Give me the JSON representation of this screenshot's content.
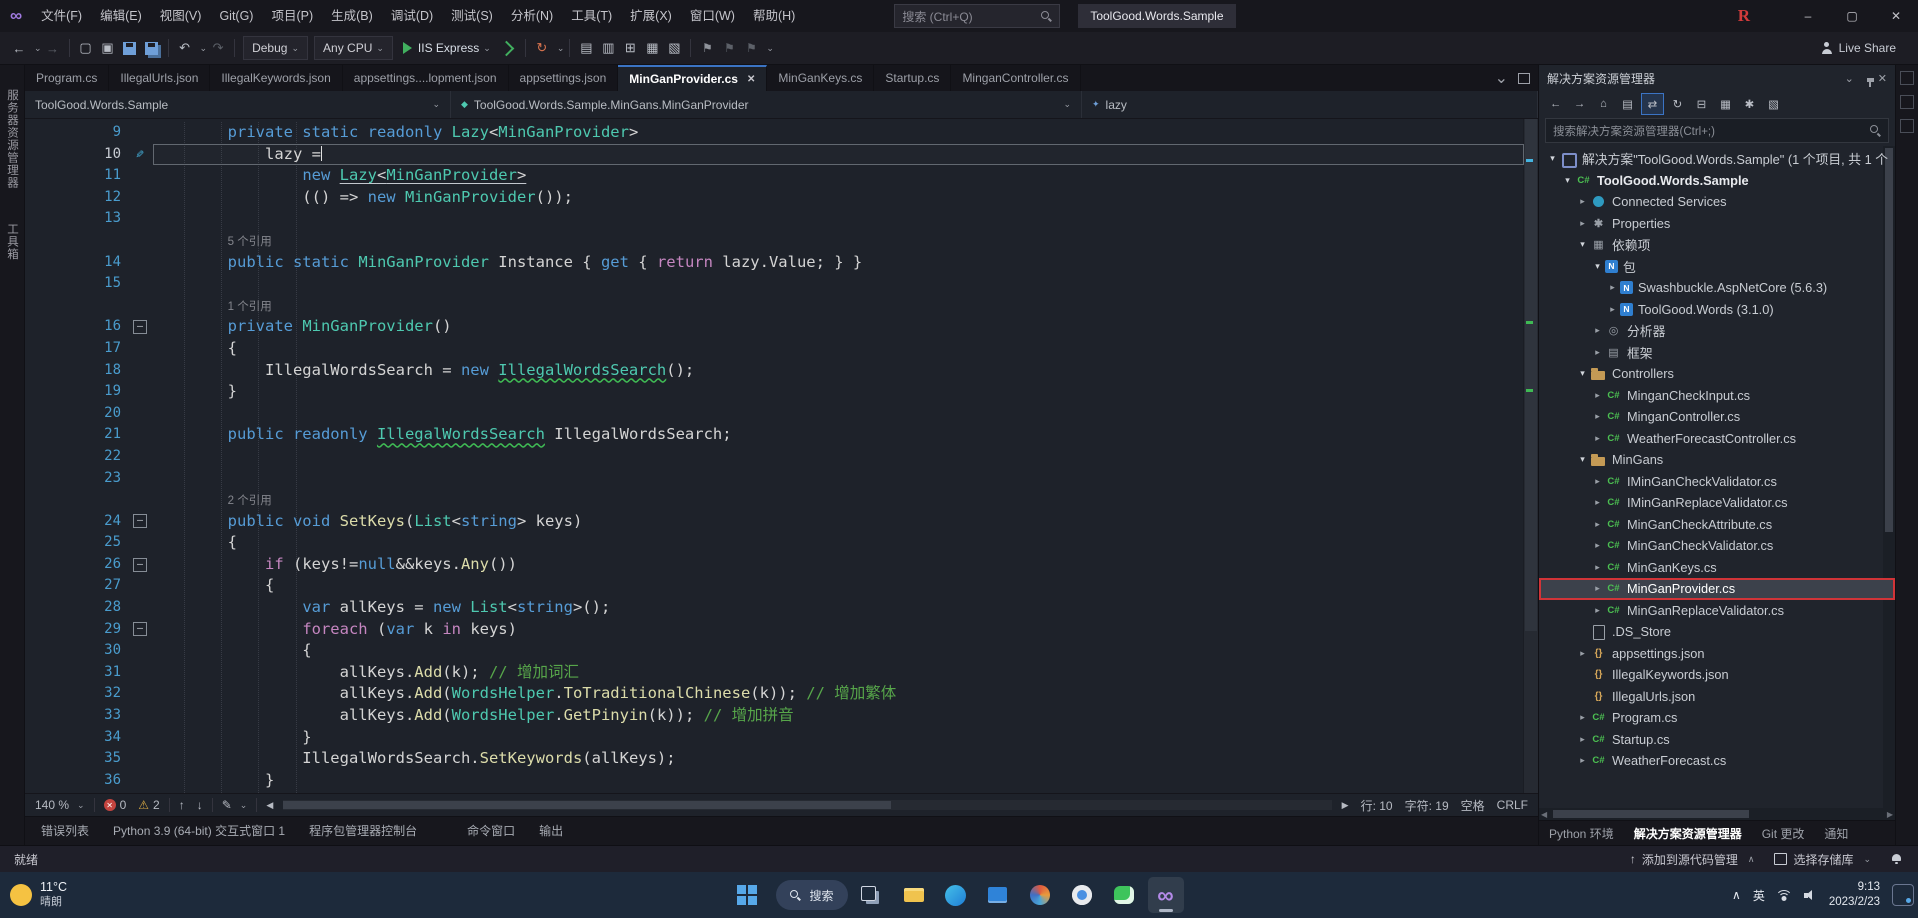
{
  "icons": {
    "minimize": "–",
    "maximize": "▢",
    "close": "✕",
    "chevron_down": "⌄",
    "chevron_up": "∧",
    "warning": "⚠",
    "pen": "✎",
    "arrow_up": "↑",
    "arrow_down": "↓",
    "arrow_left": "◀",
    "arrow_right": "▶",
    "back": "←",
    "forward": "→",
    "undo": "↶",
    "redo": "↷",
    "refresh": "↻",
    "infinity": "∞",
    "flag": "⚑",
    "tree_collapsed": "▸",
    "tree_expanded": "▾",
    "fold_minus": "–"
  },
  "titlebar": {
    "menus": [
      "文件(F)",
      "编辑(E)",
      "视图(V)",
      "Git(G)",
      "项目(P)",
      "生成(B)",
      "调试(D)",
      "测试(S)",
      "分析(N)",
      "工具(T)",
      "扩展(X)",
      "窗口(W)",
      "帮助(H)"
    ],
    "search_placeholder": "搜索 (Ctrl+Q)",
    "title_box": "ToolGood.Words.Sample",
    "r_badge": "R"
  },
  "toolbar": {
    "debug_config": "Debug",
    "platform": "Any CPU",
    "run_label": "IIS Express",
    "live_share": "Live Share"
  },
  "tabs": [
    {
      "label": "Program.cs",
      "active": false
    },
    {
      "label": "IllegalUrls.json",
      "active": false
    },
    {
      "label": "IllegalKeywords.json",
      "active": false
    },
    {
      "label": "appsettings....lopment.json",
      "active": false
    },
    {
      "label": "appsettings.json",
      "active": false
    },
    {
      "label": "MinGanProvider.cs",
      "active": true
    },
    {
      "label": "MinGanKeys.cs",
      "active": false
    },
    {
      "label": "Startup.cs",
      "active": false
    },
    {
      "label": "MinganController.cs",
      "active": false
    }
  ],
  "breadcrumb": {
    "project": "ToolGood.Words.Sample",
    "type": "ToolGood.Words.Sample.MinGans.MinGanProvider",
    "member": "lazy"
  },
  "editor": {
    "current_line": 10,
    "rows": [
      {
        "n": 9,
        "segs": [
          {
            "t": "        ",
            "c": "pl"
          },
          {
            "t": "private static readonly ",
            "c": "kw"
          },
          {
            "t": "Lazy",
            "c": "ty"
          },
          {
            "t": "<",
            "c": "pl"
          },
          {
            "t": "MinGanProvider",
            "c": "ty"
          },
          {
            "t": ">",
            "c": "pl"
          }
        ]
      },
      {
        "n": 10,
        "cur": true,
        "pen": true,
        "segs": [
          {
            "t": "            lazy =",
            "c": "pl"
          }
        ]
      },
      {
        "n": 11,
        "segs": [
          {
            "t": "                ",
            "c": "pl"
          },
          {
            "t": "new ",
            "c": "kw"
          },
          {
            "t": "Lazy",
            "c": "ty ul"
          },
          {
            "t": "<",
            "c": "pl ul"
          },
          {
            "t": "MinGanProvider",
            "c": "ty ul"
          },
          {
            "t": ">",
            "c": "pl ul"
          }
        ]
      },
      {
        "n": 12,
        "segs": [
          {
            "t": "                (() => ",
            "c": "pl"
          },
          {
            "t": "new ",
            "c": "kw"
          },
          {
            "t": "MinGanProvider",
            "c": "ty"
          },
          {
            "t": "());",
            "c": "pl"
          }
        ]
      },
      {
        "n": 13,
        "segs": []
      },
      {
        "cl": "5 个引用"
      },
      {
        "n": 14,
        "segs": [
          {
            "t": "        ",
            "c": "pl"
          },
          {
            "t": "public static ",
            "c": "kw"
          },
          {
            "t": "MinGanProvider",
            "c": "ty"
          },
          {
            "t": " Instance { ",
            "c": "pl"
          },
          {
            "t": "get",
            "c": "kw"
          },
          {
            "t": " { ",
            "c": "pl"
          },
          {
            "t": "return",
            "c": "cf"
          },
          {
            "t": " lazy.Value; } }",
            "c": "pl"
          }
        ]
      },
      {
        "n": 15,
        "segs": []
      },
      {
        "cl": "1 个引用"
      },
      {
        "n": 16,
        "fold": true,
        "segs": [
          {
            "t": "        ",
            "c": "pl"
          },
          {
            "t": "private ",
            "c": "kw"
          },
          {
            "t": "MinGanProvider",
            "c": "ty"
          },
          {
            "t": "()",
            "c": "pl"
          }
        ]
      },
      {
        "n": 17,
        "segs": [
          {
            "t": "        {",
            "c": "pl"
          }
        ]
      },
      {
        "n": 18,
        "segs": [
          {
            "t": "            IllegalWordsSearch = ",
            "c": "pl"
          },
          {
            "t": "new ",
            "c": "kw"
          },
          {
            "t": "IllegalWordsSearch",
            "c": "ty sq"
          },
          {
            "t": "();",
            "c": "pl"
          }
        ]
      },
      {
        "n": 19,
        "segs": [
          {
            "t": "        }",
            "c": "pl"
          }
        ]
      },
      {
        "n": 20,
        "segs": []
      },
      {
        "n": 21,
        "segs": [
          {
            "t": "        ",
            "c": "pl"
          },
          {
            "t": "public readonly ",
            "c": "kw"
          },
          {
            "t": "IllegalWordsSearch",
            "c": "ty sq"
          },
          {
            "t": " IllegalWordsSearch;",
            "c": "pl"
          }
        ]
      },
      {
        "n": 22,
        "segs": []
      },
      {
        "n": 23,
        "segs": []
      },
      {
        "cl": "2 个引用"
      },
      {
        "n": 24,
        "fold": true,
        "segs": [
          {
            "t": "        ",
            "c": "pl"
          },
          {
            "t": "public void ",
            "c": "kw"
          },
          {
            "t": "SetKeys",
            "c": "me"
          },
          {
            "t": "(",
            "c": "pl"
          },
          {
            "t": "List",
            "c": "ty"
          },
          {
            "t": "<",
            "c": "pl"
          },
          {
            "t": "string",
            "c": "kw"
          },
          {
            "t": "> keys)",
            "c": "pl"
          }
        ]
      },
      {
        "n": 25,
        "segs": [
          {
            "t": "        {",
            "c": "pl"
          }
        ]
      },
      {
        "n": 26,
        "fold": true,
        "segs": [
          {
            "t": "            ",
            "c": "pl"
          },
          {
            "t": "if",
            "c": "cf"
          },
          {
            "t": " (keys!=",
            "c": "pl"
          },
          {
            "t": "null",
            "c": "kw"
          },
          {
            "t": "&&keys.",
            "c": "pl"
          },
          {
            "t": "Any",
            "c": "me"
          },
          {
            "t": "())",
            "c": "pl"
          }
        ]
      },
      {
        "n": 27,
        "segs": [
          {
            "t": "            {",
            "c": "pl"
          }
        ]
      },
      {
        "n": 28,
        "segs": [
          {
            "t": "                ",
            "c": "pl"
          },
          {
            "t": "var",
            "c": "kw"
          },
          {
            "t": " allKeys = ",
            "c": "pl"
          },
          {
            "t": "new ",
            "c": "kw"
          },
          {
            "t": "List",
            "c": "ty"
          },
          {
            "t": "<",
            "c": "pl"
          },
          {
            "t": "string",
            "c": "kw"
          },
          {
            "t": ">();",
            "c": "pl"
          }
        ]
      },
      {
        "n": 29,
        "fold": true,
        "segs": [
          {
            "t": "                ",
            "c": "pl"
          },
          {
            "t": "foreach",
            "c": "cf"
          },
          {
            "t": " (",
            "c": "pl"
          },
          {
            "t": "var",
            "c": "kw"
          },
          {
            "t": " k ",
            "c": "pl"
          },
          {
            "t": "in",
            "c": "cf"
          },
          {
            "t": " keys)",
            "c": "pl"
          }
        ]
      },
      {
        "n": 30,
        "segs": [
          {
            "t": "                {",
            "c": "pl"
          }
        ]
      },
      {
        "n": 31,
        "segs": [
          {
            "t": "                    allKeys.",
            "c": "pl"
          },
          {
            "t": "Add",
            "c": "me"
          },
          {
            "t": "(k); ",
            "c": "pl"
          },
          {
            "t": "// 增加词汇",
            "c": "cm"
          }
        ]
      },
      {
        "n": 32,
        "segs": [
          {
            "t": "                    allKeys.",
            "c": "pl"
          },
          {
            "t": "Add",
            "c": "me"
          },
          {
            "t": "(",
            "c": "pl"
          },
          {
            "t": "WordsHelper",
            "c": "ty"
          },
          {
            "t": ".",
            "c": "pl"
          },
          {
            "t": "ToTraditionalChinese",
            "c": "me"
          },
          {
            "t": "(k)); ",
            "c": "pl"
          },
          {
            "t": "// 增加繁体",
            "c": "cm"
          }
        ]
      },
      {
        "n": 33,
        "segs": [
          {
            "t": "                    allKeys.",
            "c": "pl"
          },
          {
            "t": "Add",
            "c": "me"
          },
          {
            "t": "(",
            "c": "pl"
          },
          {
            "t": "WordsHelper",
            "c": "ty"
          },
          {
            "t": ".",
            "c": "pl"
          },
          {
            "t": "GetPinyin",
            "c": "me"
          },
          {
            "t": "(k)); ",
            "c": "pl"
          },
          {
            "t": "// 增加拼音",
            "c": "cm"
          }
        ]
      },
      {
        "n": 34,
        "segs": [
          {
            "t": "                }",
            "c": "pl"
          }
        ]
      },
      {
        "n": 35,
        "segs": [
          {
            "t": "                IllegalWordsSearch.",
            "c": "pl"
          },
          {
            "t": "SetKeywords",
            "c": "me"
          },
          {
            "t": "(allKeys);",
            "c": "pl"
          }
        ]
      },
      {
        "n": 36,
        "segs": [
          {
            "t": "            }",
            "c": "pl"
          }
        ]
      }
    ]
  },
  "editor_status": {
    "zoom": "140 %",
    "errors": "0",
    "warnings": "2",
    "line_label": "行: 10",
    "char_label": "字符: 19",
    "space_label": "空格",
    "eol": "CRLF"
  },
  "left_strip": {
    "tabs": [
      "服务器资源管理器",
      "工具箱"
    ]
  },
  "bottom_panel": {
    "groups": [
      [
        "错误列表",
        "Python 3.9 (64-bit) 交互式窗口 1",
        "程序包管理器控制台"
      ],
      [
        "命令窗口",
        "输出"
      ]
    ]
  },
  "solution_explorer": {
    "title": "解决方案资源管理器",
    "search_placeholder": "搜索解决方案资源管理器(Ctrl+;)",
    "toolbar_icons": [
      "back",
      "forward",
      "home",
      "switch-views",
      "sync-with-active-document",
      "refresh",
      "collapse-all",
      "show-all-files",
      "properties",
      "preview"
    ],
    "tree": [
      {
        "level": 0,
        "arrow": "e",
        "icon": "sln",
        "label": "解决方案\"ToolGood.Words.Sample\" (1 个项目, 共 1 个"
      },
      {
        "level": 1,
        "arrow": "e",
        "icon": "proj",
        "label": "ToolGood.Words.Sample",
        "bold": true
      },
      {
        "level": 2,
        "arrow": "c",
        "icon": "svc",
        "label": "Connected Services"
      },
      {
        "level": 2,
        "arrow": "c",
        "icon": "props",
        "label": "Properties"
      },
      {
        "level": 2,
        "arrow": "e",
        "icon": "dep",
        "label": "依赖项"
      },
      {
        "level": 3,
        "arrow": "e",
        "icon": "nuget",
        "label": "包"
      },
      {
        "level": 4,
        "arrow": "c",
        "icon": "pkg",
        "label": "Swashbuckle.AspNetCore (5.6.3)"
      },
      {
        "level": 4,
        "arrow": "c",
        "icon": "pkg",
        "label": "ToolGood.Words (3.1.0)"
      },
      {
        "level": 3,
        "arrow": "c",
        "icon": "analyzer",
        "label": "分析器"
      },
      {
        "level": 3,
        "arrow": "c",
        "icon": "fw",
        "label": "框架"
      },
      {
        "level": 2,
        "arrow": "e",
        "icon": "folder",
        "label": "Controllers"
      },
      {
        "level": 3,
        "arrow": "c",
        "icon": "cs",
        "label": "MinganCheckInput.cs"
      },
      {
        "level": 3,
        "arrow": "c",
        "icon": "cs",
        "label": "MinganController.cs"
      },
      {
        "level": 3,
        "arrow": "c",
        "icon": "cs",
        "label": "WeatherForecastController.cs"
      },
      {
        "level": 2,
        "arrow": "e",
        "icon": "folder",
        "label": "MinGans"
      },
      {
        "level": 3,
        "arrow": "c",
        "icon": "cs",
        "label": "IMinGanCheckValidator.cs"
      },
      {
        "level": 3,
        "arrow": "c",
        "icon": "cs",
        "label": "IMinGanReplaceValidator.cs"
      },
      {
        "level": 3,
        "arrow": "c",
        "icon": "cs",
        "label": "MinGanCheckAttribute.cs"
      },
      {
        "level": 3,
        "arrow": "c",
        "icon": "cs",
        "label": "MinGanCheckValidator.cs"
      },
      {
        "level": 3,
        "arrow": "c",
        "icon": "cs",
        "label": "MinGanKeys.cs"
      },
      {
        "level": 3,
        "arrow": "c",
        "icon": "cs",
        "label": "MinGanProvider.cs",
        "selected": true
      },
      {
        "level": 3,
        "arrow": "c",
        "icon": "cs",
        "label": "MinGanReplaceValidator.cs"
      },
      {
        "level": 2,
        "arrow": "n",
        "icon": "file",
        "label": ".DS_Store"
      },
      {
        "level": 2,
        "arrow": "c",
        "icon": "json",
        "label": "appsettings.json"
      },
      {
        "level": 2,
        "arrow": "n",
        "icon": "json",
        "label": "IllegalKeywords.json"
      },
      {
        "level": 2,
        "arrow": "n",
        "icon": "json",
        "label": "IllegalUrls.json"
      },
      {
        "level": 2,
        "arrow": "c",
        "icon": "cs",
        "label": "Program.cs"
      },
      {
        "level": 2,
        "arrow": "c",
        "icon": "cs",
        "label": "Startup.cs"
      },
      {
        "level": 2,
        "arrow": "c",
        "icon": "cs",
        "label": "WeatherForecast.cs"
      }
    ],
    "dock_tabs": [
      {
        "label": "Python 环境",
        "active": false
      },
      {
        "label": "解决方案资源管理器",
        "active": true
      },
      {
        "label": "Git 更改",
        "active": false
      },
      {
        "label": "通知",
        "active": false
      }
    ]
  },
  "status_bar": {
    "ready": "就绪",
    "add_scc": "添加到源代码管理",
    "select_repo": "选择存储库"
  },
  "taskbar": {
    "weather_temp": "11°C",
    "weather_desc": "晴朗",
    "search_label": "搜索",
    "icons": [
      "task-view",
      "file-explorer",
      "edge",
      "microsoft-store",
      "photos",
      "chrome",
      "wechat",
      "visual-studio"
    ],
    "active_icon": "visual-studio",
    "lang": "英",
    "time": "9:13",
    "date": "2023/2/23"
  },
  "colors": {
    "accent_blue": "#3b74c4",
    "keyword_blue": "#569cd6",
    "type_teal": "#4ec9b0",
    "method_yellow": "#dcdcaa",
    "comment_green": "#57a64a",
    "control_purple": "#c586c0",
    "selection_red": "#d13438",
    "error_red": "#c4443f",
    "warning_yellow": "#d9a943"
  }
}
